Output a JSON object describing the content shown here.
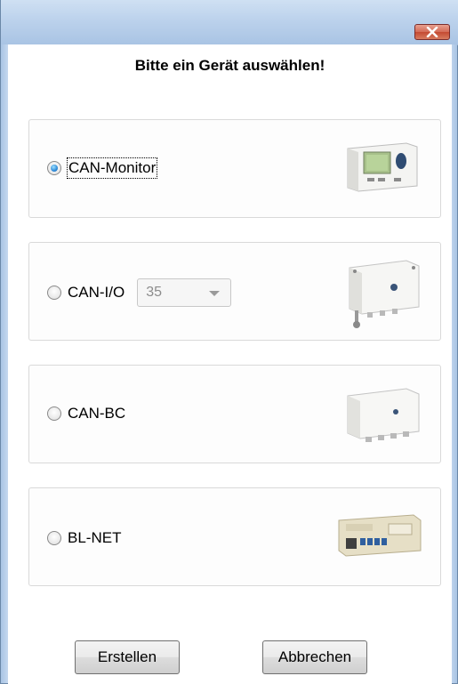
{
  "window": {
    "close_icon": "close-x-icon"
  },
  "heading": "Bitte ein Gerät auswählen!",
  "devices": [
    {
      "label": "CAN-Monitor",
      "checked": true,
      "image_icon": "can-monitor-device-image"
    },
    {
      "label": "CAN-I/O",
      "checked": false,
      "combo_value": "35",
      "image_icon": "can-io-device-image"
    },
    {
      "label": "CAN-BC",
      "checked": false,
      "image_icon": "can-bc-device-image"
    },
    {
      "label": "BL-NET",
      "checked": false,
      "image_icon": "bl-net-device-image"
    }
  ],
  "buttons": {
    "create": "Erstellen",
    "cancel": "Abbrechen"
  }
}
